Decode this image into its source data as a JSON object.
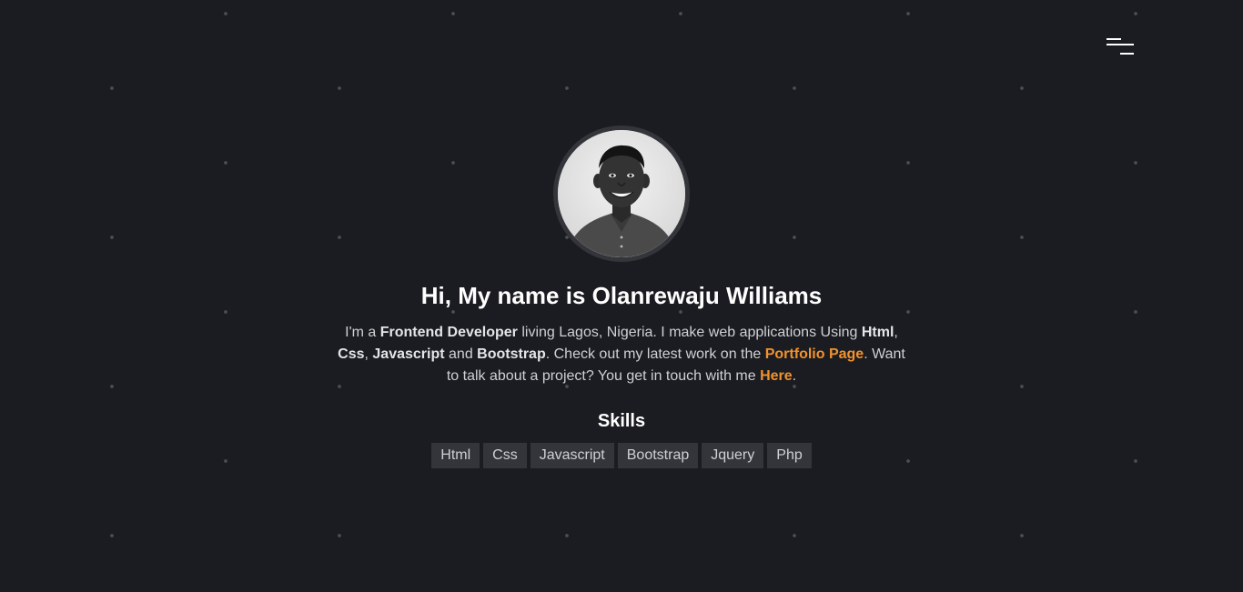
{
  "nav": {
    "menu_icon": "hamburger-menu-icon"
  },
  "profile": {
    "avatar_alt": "Olanrewaju Williams"
  },
  "hero": {
    "title": "Hi, My name is Olanrewaju Williams",
    "intro": {
      "t1": "I'm a ",
      "role": "Frontend Developer",
      "t2": " living Lagos, Nigeria. I make web applications Using ",
      "s_html": "Html",
      "t3": ", ",
      "s_css": "Css",
      "t4": ", ",
      "s_js": "Javascript",
      "t5": " and ",
      "s_bootstrap": "Bootstrap",
      "t6": ". Check out my latest work on the ",
      "portfolio_link": "Portfolio Page",
      "t7": ". Want to talk about a project? You get in touch with me ",
      "contact_link": "Here",
      "t8": "."
    }
  },
  "skills": {
    "heading": "Skills",
    "items": [
      "Html",
      "Css",
      "Javascript",
      "Bootstrap",
      "Jquery",
      "Php"
    ]
  },
  "colors": {
    "background": "#1b1c21",
    "accent": "#f0922e",
    "tag_bg": "#34353b"
  }
}
